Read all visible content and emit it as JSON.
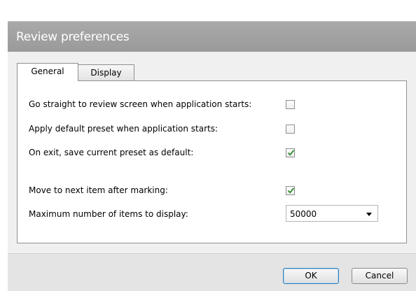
{
  "dialog": {
    "title": "Review preferences"
  },
  "tabs": [
    {
      "label": "General",
      "active": true
    },
    {
      "label": "Display",
      "active": false
    }
  ],
  "general": {
    "options": [
      {
        "label": "Go straight to review screen when application starts:",
        "checked": false
      },
      {
        "label": "Apply default preset when application starts:",
        "checked": false
      },
      {
        "label": "On exit, save current preset as default:",
        "checked": true
      },
      {
        "label": "Move to next item after marking:",
        "checked": true
      }
    ],
    "max_items": {
      "label": "Maximum number of items to display:",
      "value": "50000"
    }
  },
  "buttons": {
    "ok": "OK",
    "cancel": "Cancel"
  },
  "colors": {
    "checkmark": "#2a8a2a",
    "title_bar": "#a3a3a3",
    "ok_border": "#3c7fb1"
  }
}
